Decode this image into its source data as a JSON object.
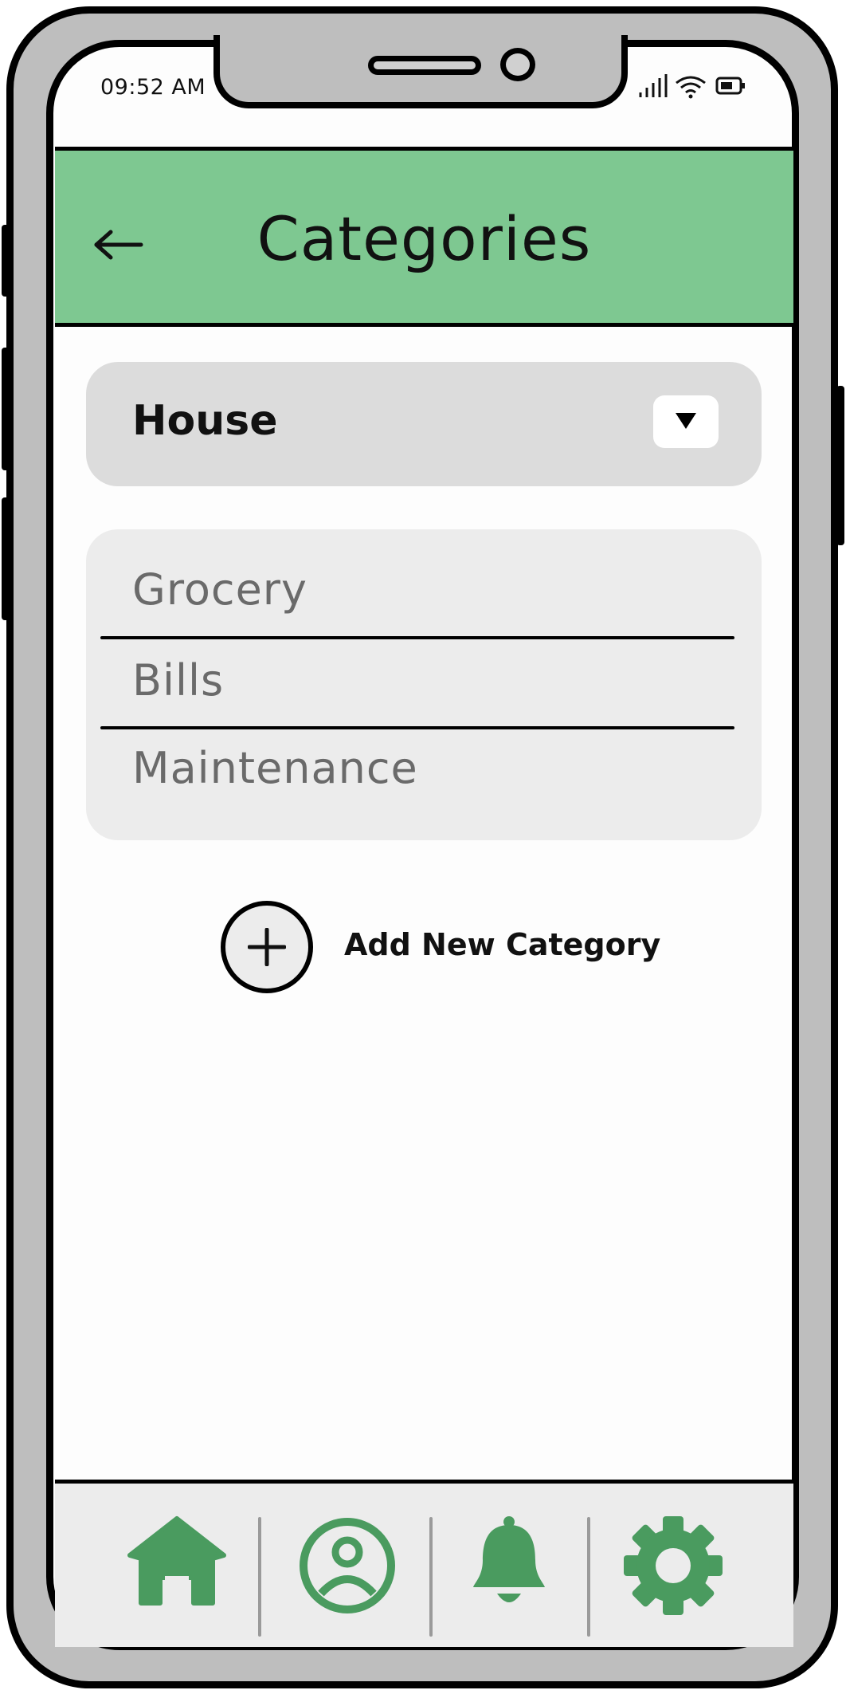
{
  "status_bar": {
    "time": "09:52 AM",
    "signal_icon": "signal-bars-icon",
    "wifi_icon": "wifi-icon",
    "battery_icon": "battery-icon"
  },
  "header": {
    "title": "Categories",
    "back_icon": "back-arrow-icon",
    "background_color": "#7ec891"
  },
  "category_select": {
    "selected": "House",
    "icon": "caret-down-icon"
  },
  "subcategories": [
    {
      "label": "Grocery"
    },
    {
      "label": "Bills"
    },
    {
      "label": "Maintenance"
    }
  ],
  "add_category": {
    "label": "Add New Category",
    "icon": "plus-circle-icon"
  },
  "bottom_nav": {
    "accent_color": "#4a9b5f",
    "items": [
      {
        "icon": "home-icon"
      },
      {
        "icon": "profile-icon"
      },
      {
        "icon": "bell-icon"
      },
      {
        "icon": "gear-icon"
      }
    ]
  }
}
